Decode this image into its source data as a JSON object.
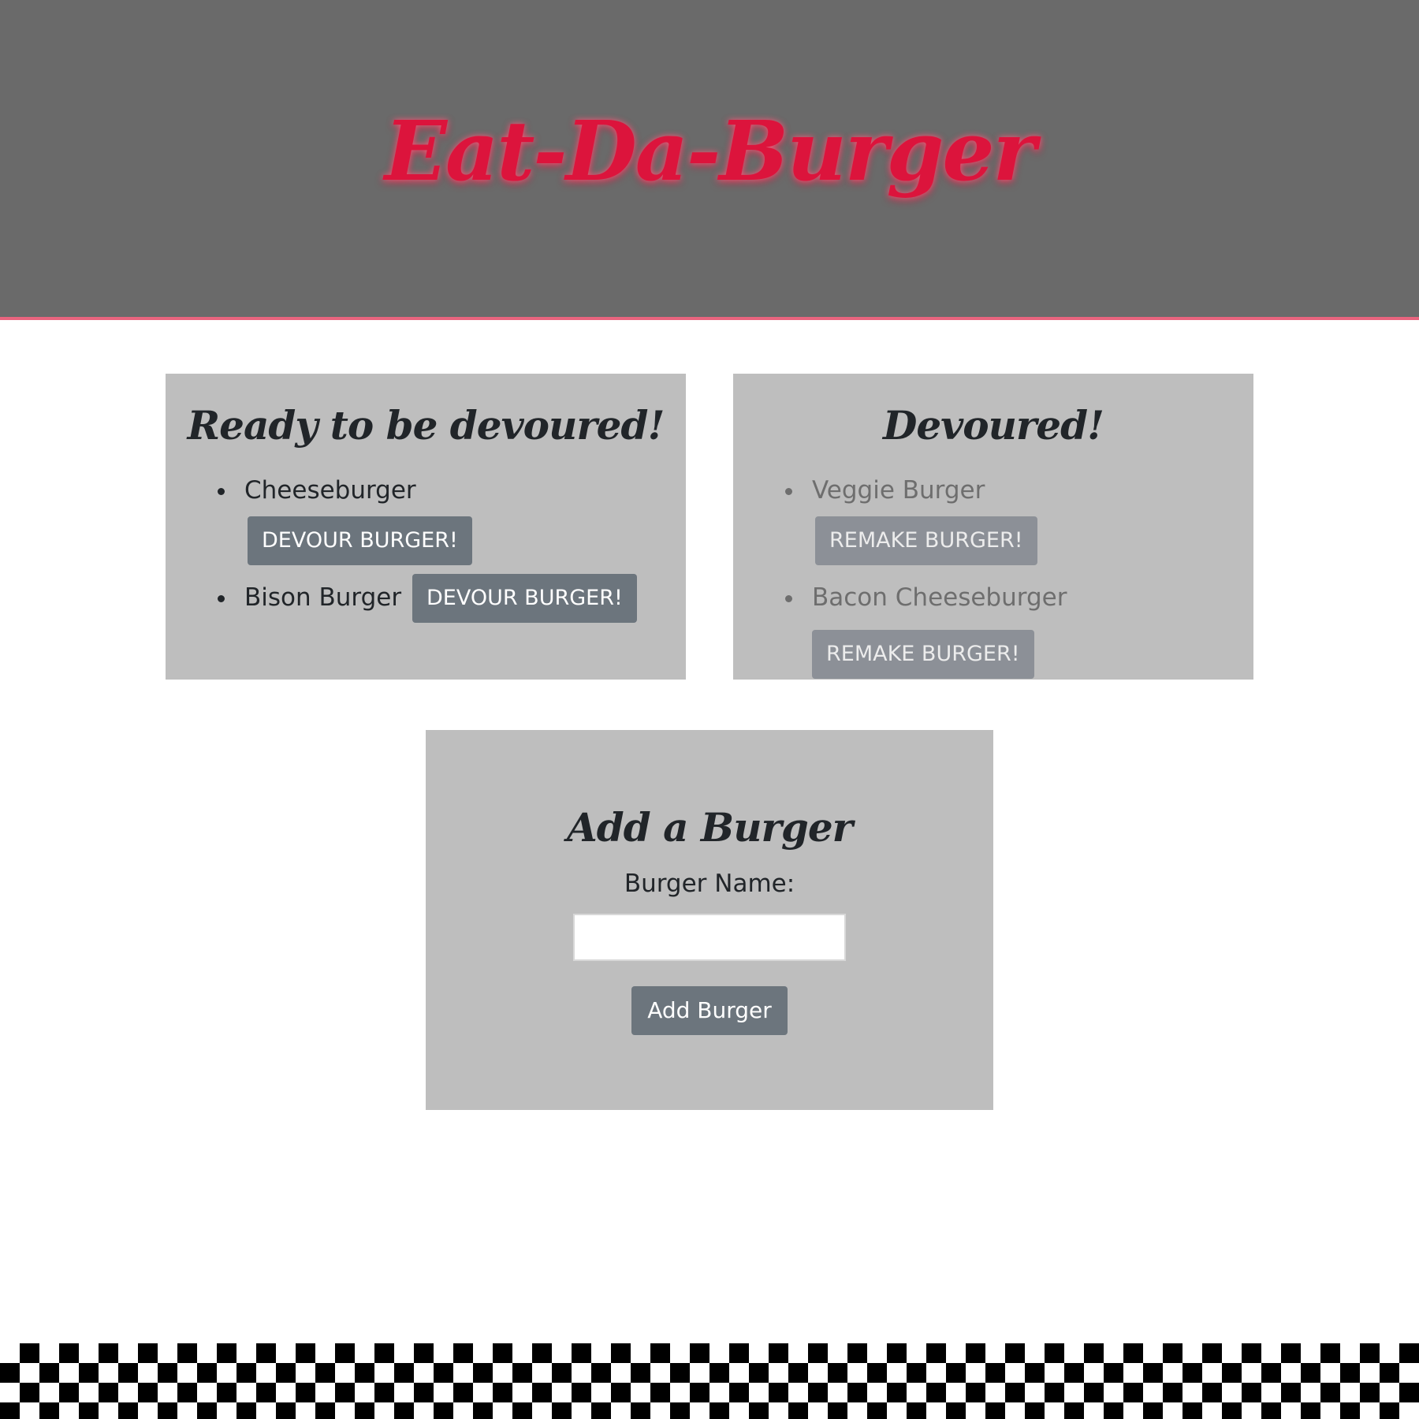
{
  "header": {
    "title": "Eat-Da-Burger",
    "title_color": "#dc143c",
    "background": "#6a6a6a",
    "accent_border": "#e8647e"
  },
  "ready": {
    "title": "Ready to be devoured!",
    "items": [
      {
        "name": "Cheeseburger",
        "button": "DEVOUR BURGER!"
      },
      {
        "name": "Bison Burger",
        "button": "DEVOUR BURGER!"
      }
    ]
  },
  "devoured": {
    "title": "Devoured!",
    "items": [
      {
        "name": "Veggie Burger",
        "button": "REMAKE BURGER!"
      },
      {
        "name": "Bacon Cheeseburger",
        "button": "REMAKE BURGER!"
      }
    ]
  },
  "add_form": {
    "title": "Add a Burger",
    "label": "Burger Name:",
    "input_value": "",
    "submit_label": "Add Burger"
  },
  "footer": {
    "pattern": "checkerboard",
    "colors": [
      "#000000",
      "#ffffff"
    ]
  }
}
